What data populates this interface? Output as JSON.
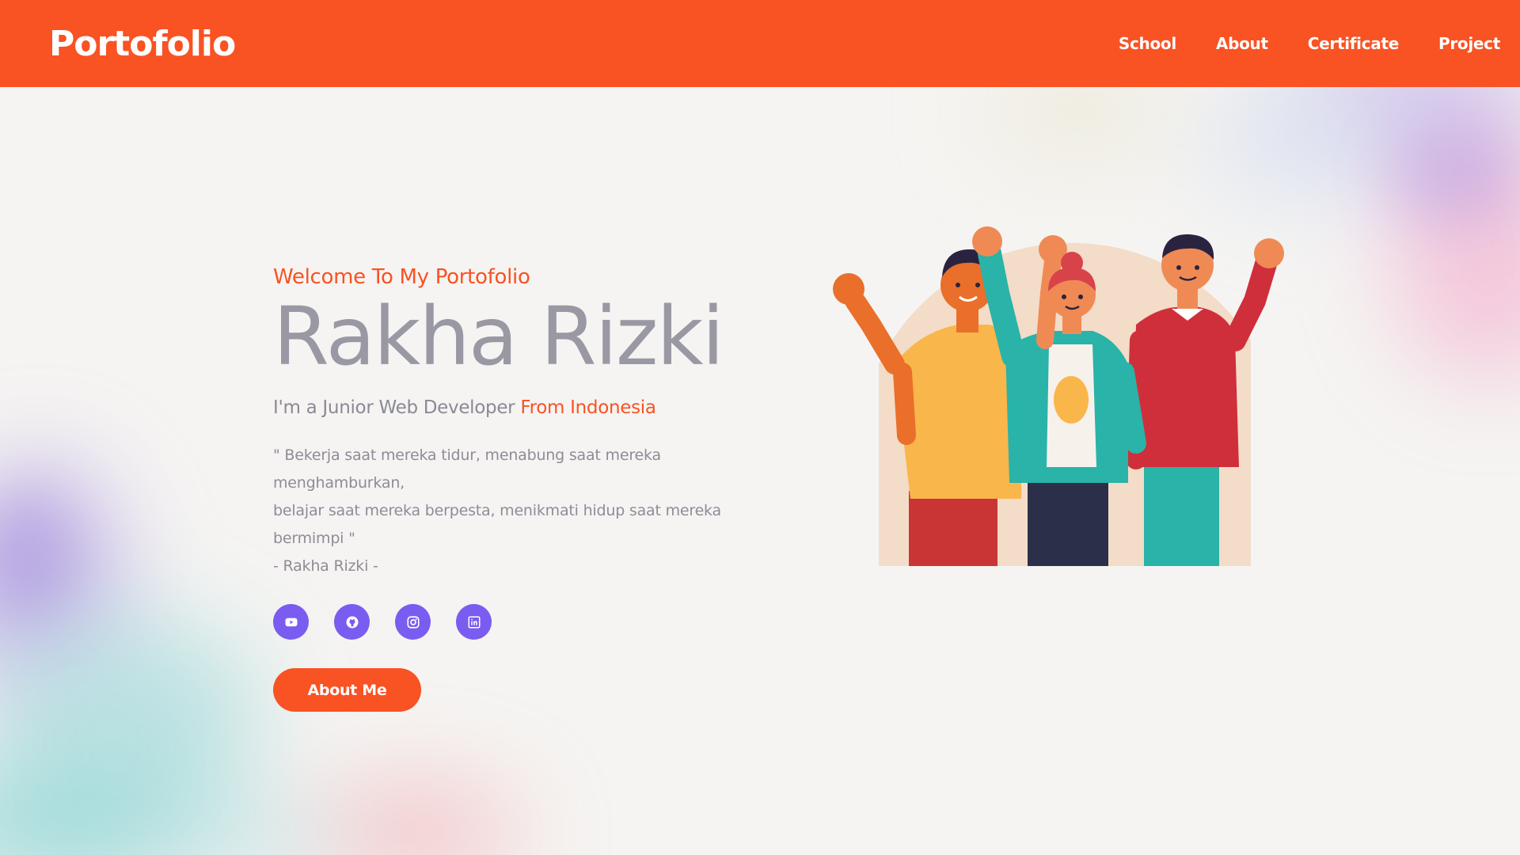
{
  "navbar": {
    "brand": "Portofolio",
    "links": [
      "School",
      "About",
      "Certificate",
      "Project"
    ]
  },
  "hero": {
    "welcome": "Welcome To My Portofolio",
    "name": "Rakha Rizki",
    "tagline_prefix": "I'm a Junior Web Developer ",
    "tagline_accent": "From Indonesia",
    "quote_line1": "\" Bekerja saat mereka tidur, menabung saat mereka menghamburkan,",
    "quote_line2": "belajar saat mereka berpesta, menikmati hidup saat mereka bermimpi \"",
    "quote_author": "- Rakha Rizki -",
    "button_label": "About Me"
  },
  "socials": [
    {
      "icon": "youtube-icon"
    },
    {
      "icon": "github-icon"
    },
    {
      "icon": "instagram-icon"
    },
    {
      "icon": "linkedin-icon"
    }
  ],
  "colors": {
    "primary": "#f95223",
    "social_bg": "#7b5cf0",
    "text_gray": "#9a98a3",
    "background": "#f5f4f2"
  }
}
